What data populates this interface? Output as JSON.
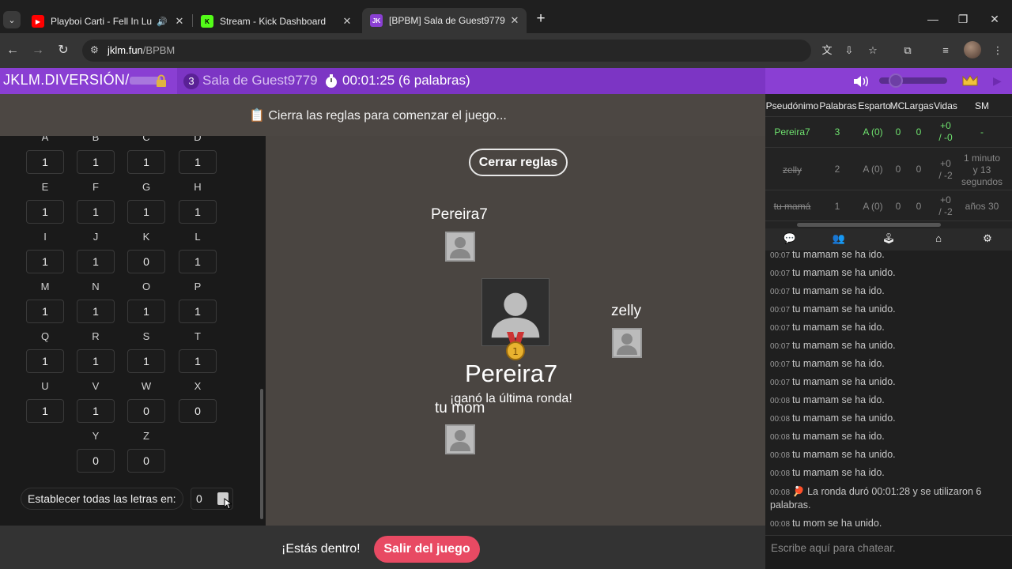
{
  "browser": {
    "tabs": [
      {
        "title": "Playboi Carti - Fell In Luv (U",
        "favicon": "youtube-icon",
        "color": "#ff0000"
      },
      {
        "title": "Stream - Kick Dashboard",
        "favicon": "kick-icon",
        "color": "#53fc18"
      },
      {
        "title": "[BPBM] Sala de Guest9779",
        "favicon": "jklm-icon",
        "color": "#8a3fd3"
      }
    ],
    "url_domain": "jklm.fun",
    "url_path": "/BPBM"
  },
  "gamebar": {
    "brand": "JKLM.DIVERSIÓN/",
    "room_count": "3",
    "room_name": "Sala de Guest9779",
    "timer": "00:01:25 (6 palabras)"
  },
  "rules": {
    "notice": "📋 Cierra las reglas para comenzar el juego...",
    "close_label": "Cerrar reglas"
  },
  "letters": [
    {
      "letter": "A",
      "value": "1"
    },
    {
      "letter": "B",
      "value": "1"
    },
    {
      "letter": "C",
      "value": "1"
    },
    {
      "letter": "D",
      "value": "1"
    },
    {
      "letter": "E",
      "value": "1"
    },
    {
      "letter": "F",
      "value": "1"
    },
    {
      "letter": "G",
      "value": "1"
    },
    {
      "letter": "H",
      "value": "1"
    },
    {
      "letter": "I",
      "value": "1"
    },
    {
      "letter": "J",
      "value": "1"
    },
    {
      "letter": "K",
      "value": "0"
    },
    {
      "letter": "L",
      "value": "1"
    },
    {
      "letter": "M",
      "value": "1"
    },
    {
      "letter": "N",
      "value": "1"
    },
    {
      "letter": "O",
      "value": "1"
    },
    {
      "letter": "P",
      "value": "1"
    },
    {
      "letter": "Q",
      "value": "1"
    },
    {
      "letter": "R",
      "value": "1"
    },
    {
      "letter": "S",
      "value": "1"
    },
    {
      "letter": "T",
      "value": "1"
    },
    {
      "letter": "U",
      "value": "1"
    },
    {
      "letter": "V",
      "value": "1"
    },
    {
      "letter": "W",
      "value": "0"
    },
    {
      "letter": "X",
      "value": "0"
    },
    {
      "letter": "Y",
      "value": "0"
    },
    {
      "letter": "Z",
      "value": "0"
    }
  ],
  "set_all": {
    "label": "Establecer todas las letras en:",
    "value": "0"
  },
  "players": {
    "p1": "Pereira7",
    "p2": "zelly",
    "p3": "tu mom",
    "winner": "Pereira7",
    "winner_sub": "¡ganó la última ronda!"
  },
  "bottom": {
    "in_label": "¡Estás dentro!",
    "leave_label": "Salir del juego"
  },
  "table": {
    "headers": [
      "Pseudónimo",
      "Palabras",
      "Esparto",
      "MC",
      "Largas",
      "Vidas",
      "SM"
    ],
    "rows": [
      {
        "name": "Pereira7",
        "words": "3",
        "esparto": "A (0)",
        "mc": "0",
        "largas": "0",
        "vidas1": "+0",
        "vidas2": "/ -0",
        "sm": "-"
      },
      {
        "name": "zelly",
        "words": "2",
        "esparto": "A (0)",
        "mc": "0",
        "largas": "0",
        "vidas1": "+0",
        "vidas2": "/ -2",
        "sm1": "1 minuto",
        "sm2": "y 13",
        "sm3": "segundos"
      },
      {
        "name": "tu mamá",
        "words": "1",
        "esparto": "A (0)",
        "mc": "0",
        "largas": "0",
        "vidas1": "+0",
        "vidas2": "/ -2",
        "sm": "años 30"
      }
    ]
  },
  "chat": {
    "messages": [
      {
        "t": "00:07",
        "text": "tu mamam se ha ido."
      },
      {
        "t": "00:07",
        "text": "tu mamam se ha unido."
      },
      {
        "t": "00:07",
        "text": "tu mamam se ha ido."
      },
      {
        "t": "00:07",
        "text": "tu mamam se ha unido."
      },
      {
        "t": "00:07",
        "text": "tu mamam se ha ido."
      },
      {
        "t": "00:07",
        "text": "tu mamam se ha unido."
      },
      {
        "t": "00:07",
        "text": "tu mamam se ha ido."
      },
      {
        "t": "00:07",
        "text": "tu mamam se ha unido."
      },
      {
        "t": "00:08",
        "text": "tu mamam se ha ido."
      },
      {
        "t": "00:08",
        "text": "tu mamam se ha unido."
      },
      {
        "t": "00:08",
        "text": "tu mamam se ha ido."
      },
      {
        "t": "00:08",
        "text": "tu mamam se ha unido."
      },
      {
        "t": "00:08",
        "text": "tu mamam se ha ido."
      }
    ],
    "round_t": "00:08",
    "round_line1": "🏓 La ronda duró 00:01:28 y se utilizaron 6",
    "round_line2": "palabras.",
    "last_t": "00:08",
    "last_text": "tu mom se ha unido.",
    "placeholder": "Escribe aquí para chatear."
  },
  "colors": {
    "accent": "#8a3fd3",
    "leave": "#e84a63",
    "highlight": "#6fe36f"
  }
}
